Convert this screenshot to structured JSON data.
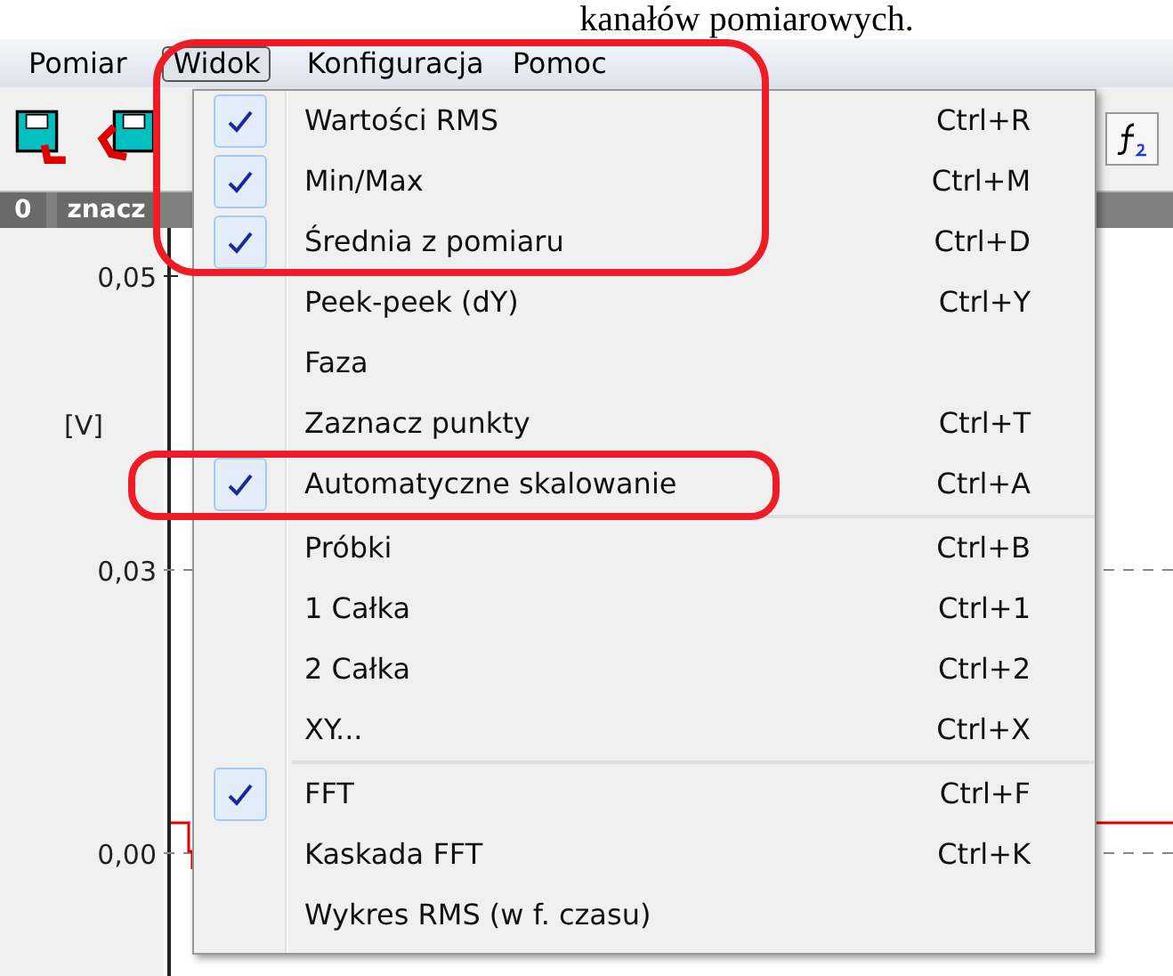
{
  "caption": "kanałów pomiarowych.",
  "menubar": [
    {
      "label": "Pomiar",
      "selected": false
    },
    {
      "label": "Widok",
      "selected": true
    },
    {
      "label": "Konfiguracja",
      "selected": false
    },
    {
      "label": "Pomoc",
      "selected": false
    }
  ],
  "channel_header": {
    "column_1": "0",
    "column_2": "znacz"
  },
  "y_axis": {
    "unit": "[V]",
    "ticks": [
      "0,05",
      "0,03",
      "0,00"
    ]
  },
  "menu": {
    "groups": [
      [
        {
          "label": "Wartości RMS",
          "shortcut": "Ctrl+R",
          "checked": true
        },
        {
          "label": "Min/Max",
          "shortcut": "Ctrl+M",
          "checked": true
        },
        {
          "label": "Średnia z pomiaru",
          "shortcut": "Ctrl+D",
          "checked": true
        },
        {
          "label": "Peek-peek (dY)",
          "shortcut": "Ctrl+Y",
          "checked": false
        },
        {
          "label": "Faza",
          "checked": false
        },
        {
          "label": "Zaznacz punkty",
          "shortcut": "Ctrl+T",
          "checked": false
        },
        {
          "label": "Automatyczne skalowanie",
          "shortcut": "Ctrl+A",
          "checked": true
        }
      ],
      [
        {
          "label": "Próbki",
          "shortcut": "Ctrl+B",
          "checked": false
        },
        {
          "label": "1 Całka",
          "shortcut": "Ctrl+1",
          "checked": false
        },
        {
          "label": "2 Całka",
          "shortcut": "Ctrl+2",
          "checked": false
        },
        {
          "label": "XY...",
          "shortcut": "Ctrl+X",
          "checked": false
        }
      ],
      [
        {
          "label": "FFT",
          "shortcut": "Ctrl+F",
          "checked": true
        },
        {
          "label": "Kaskada FFT",
          "shortcut": "Ctrl+K",
          "checked": false
        },
        {
          "label": "Wykres RMS (w f. czasu)",
          "checked": false
        }
      ]
    ]
  }
}
